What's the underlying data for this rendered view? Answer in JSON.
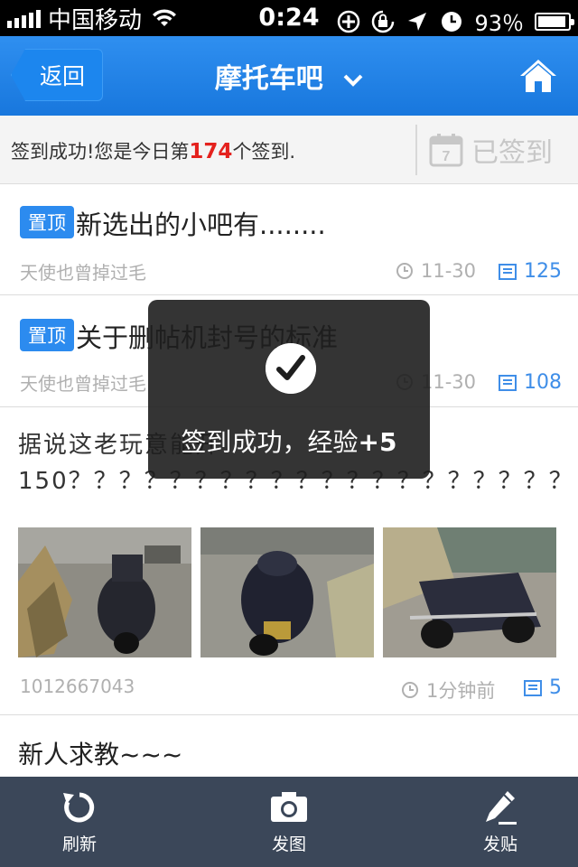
{
  "status_bar": {
    "carrier": "中国移动",
    "time": "0:24",
    "battery": "93％",
    "battery_level": 0.93
  },
  "nav": {
    "back_label": "返回",
    "title": "摩托车吧",
    "chevron_icon": "chevron-down-icon",
    "home_icon": "home-icon"
  },
  "sign": {
    "prefix": "签到成功!您是今日第",
    "rank": "174",
    "suffix": "个签到.",
    "signed_label": "已签到",
    "calendar_day": "7"
  },
  "posts": [
    {
      "badge": "置顶",
      "title": "新选出的小吧有........",
      "author": "天使也曾掉过毛",
      "date": "11-30",
      "replies": "125"
    },
    {
      "badge": "置顶",
      "title": "关于删帖机封号的标准",
      "author": "天使也曾掉过毛",
      "date": "11-30",
      "replies": "108"
    },
    {
      "body": "据说这老玩意能开150？？？？？？？？？？？？？？？？？？？？",
      "author": "1012667043",
      "date": "1分钟前",
      "replies": "5"
    },
    {
      "title": "新人求教~~~"
    }
  ],
  "toast": {
    "message": "签到成功，经验",
    "bonus": "+5"
  },
  "tabbar": [
    {
      "label": "刷新",
      "icon": "refresh-icon"
    },
    {
      "label": "发图",
      "icon": "camera-icon"
    },
    {
      "label": "发贴",
      "icon": "pencil-icon"
    }
  ],
  "colors": {
    "nav_blue": "#1877dd",
    "accent_red": "#e4211d",
    "reply_blue": "#3f8ee8",
    "tabbar_bg": "#3b4759"
  }
}
